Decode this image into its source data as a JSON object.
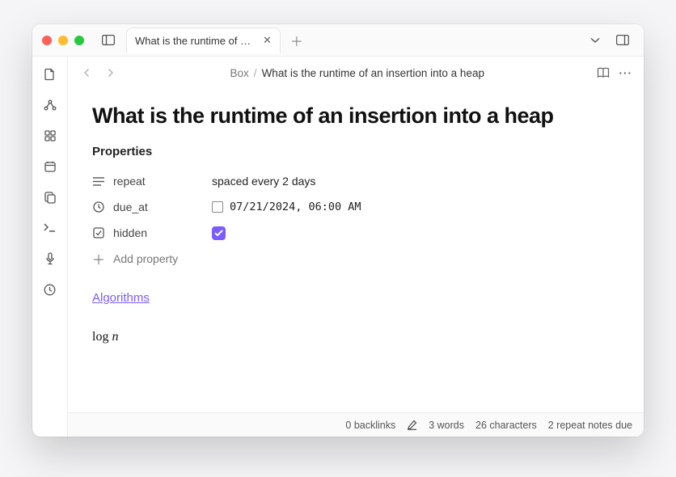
{
  "tab": {
    "title": "What is the runtime of an…"
  },
  "breadcrumb": {
    "root": "Box",
    "current": "What is the runtime of an insertion into a heap"
  },
  "page": {
    "title": "What is the runtime of an insertion into a heap",
    "properties_header": "Properties",
    "props": {
      "repeat": {
        "label": "repeat",
        "value": "spaced every 2 days"
      },
      "due_at": {
        "label": "due_at",
        "value": "07/21/2024, 06:00 AM"
      },
      "hidden": {
        "label": "hidden",
        "checked": true
      }
    },
    "add_property": "Add property",
    "link_text": "Algorithms",
    "math_text": "log n"
  },
  "status": {
    "backlinks": "0 backlinks",
    "words": "3 words",
    "chars": "26 characters",
    "repeat_due": "2 repeat notes due"
  }
}
